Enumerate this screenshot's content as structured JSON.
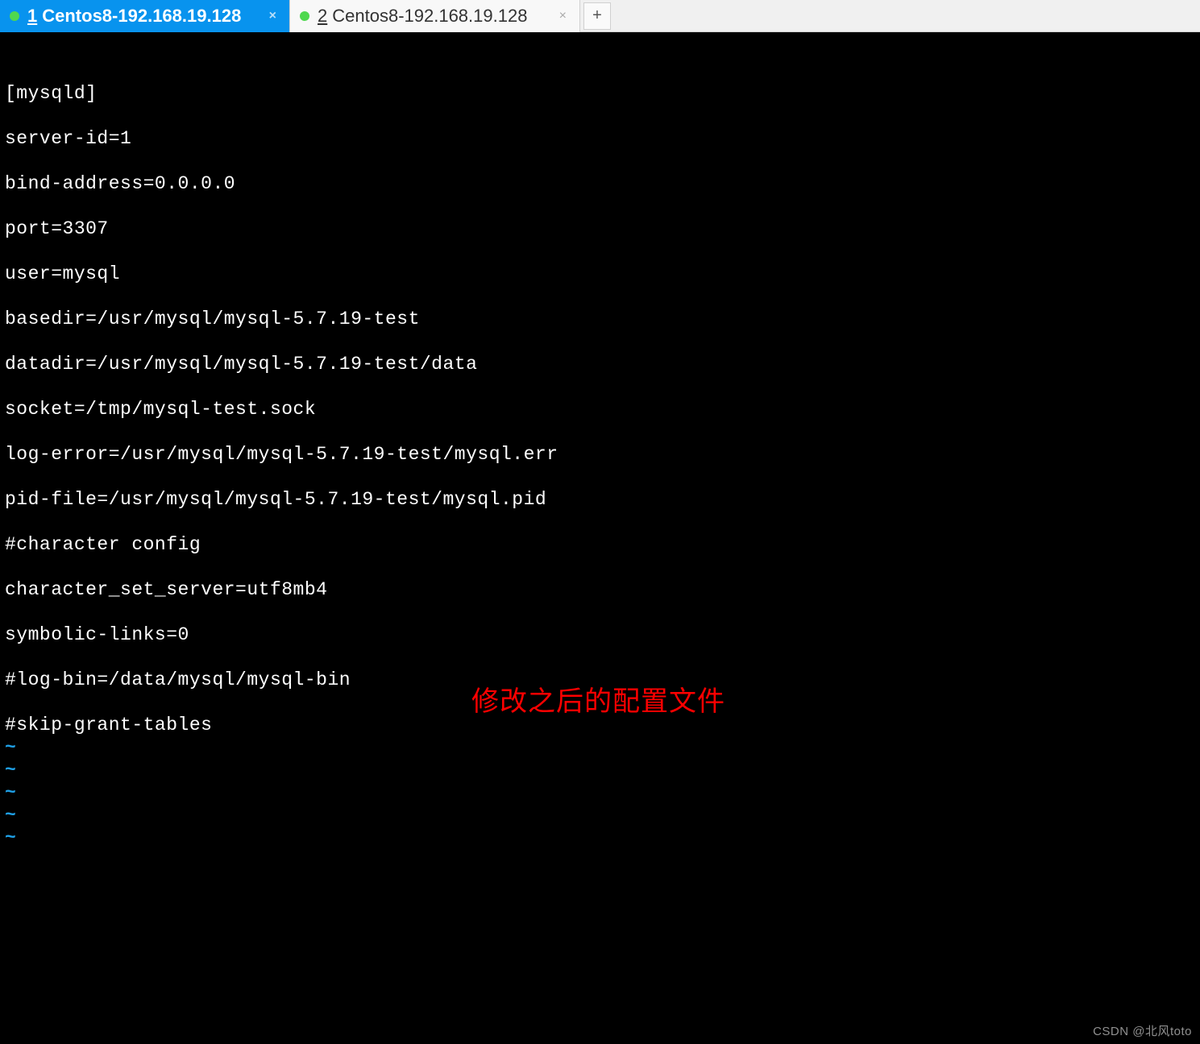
{
  "tabs": [
    {
      "number": "1",
      "label": "Centos8-192.168.19.128",
      "active": true
    },
    {
      "number": "2",
      "label": "Centos8-192.168.19.128",
      "active": false
    }
  ],
  "new_tab_label": "+",
  "terminal_lines": [
    "[mysqld]",
    "",
    "server-id=1",
    "",
    "bind-address=0.0.0.0",
    "",
    "port=3307",
    "",
    "user=mysql",
    "",
    "basedir=/usr/mysql/mysql-5.7.19-test",
    "",
    "datadir=/usr/mysql/mysql-5.7.19-test/data",
    "",
    "socket=/tmp/mysql-test.sock",
    "",
    "log-error=/usr/mysql/mysql-5.7.19-test/mysql.err",
    "",
    "pid-file=/usr/mysql/mysql-5.7.19-test/mysql.pid",
    "",
    "#character config",
    "",
    "character_set_server=utf8mb4",
    "",
    "symbolic-links=0",
    "",
    "#log-bin=/data/mysql/mysql-bin",
    "",
    "#skip-grant-tables"
  ],
  "tilde_count": 5,
  "tilde_char": "~",
  "annotation_text": "修改之后的配置文件",
  "watermark_text": "CSDN @北风toto",
  "close_glyph": "×"
}
